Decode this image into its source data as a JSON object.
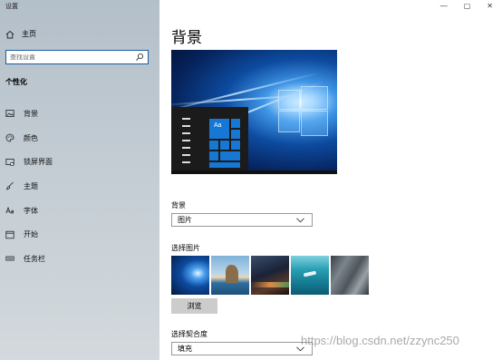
{
  "window": {
    "title": "设置",
    "controls": [
      "—",
      "▢",
      "✕"
    ]
  },
  "sidebar": {
    "home_label": "主页",
    "search_placeholder": "查找设置",
    "section_title": "个性化",
    "items": [
      {
        "label": "背景",
        "icon": "picture-icon"
      },
      {
        "label": "颜色",
        "icon": "palette-icon"
      },
      {
        "label": "锁屏界面",
        "icon": "lock-screen-icon"
      },
      {
        "label": "主题",
        "icon": "brush-icon"
      },
      {
        "label": "字体",
        "icon": "font-icon"
      },
      {
        "label": "开始",
        "icon": "start-icon"
      },
      {
        "label": "任务栏",
        "icon": "taskbar-icon"
      }
    ]
  },
  "main": {
    "title": "背景",
    "preview_tile_text": "Aa",
    "background_label": "背景",
    "background_value": "图片",
    "choose_picture_label": "选择图片",
    "browse_label": "浏览",
    "fit_label": "选择契合度",
    "fit_value": "填充",
    "thumbnails": [
      "windows-hero",
      "beach-rock",
      "night-sky",
      "underwater",
      "rock-cliff"
    ]
  },
  "watermark": "https://blog.csdn.net/zzync250"
}
